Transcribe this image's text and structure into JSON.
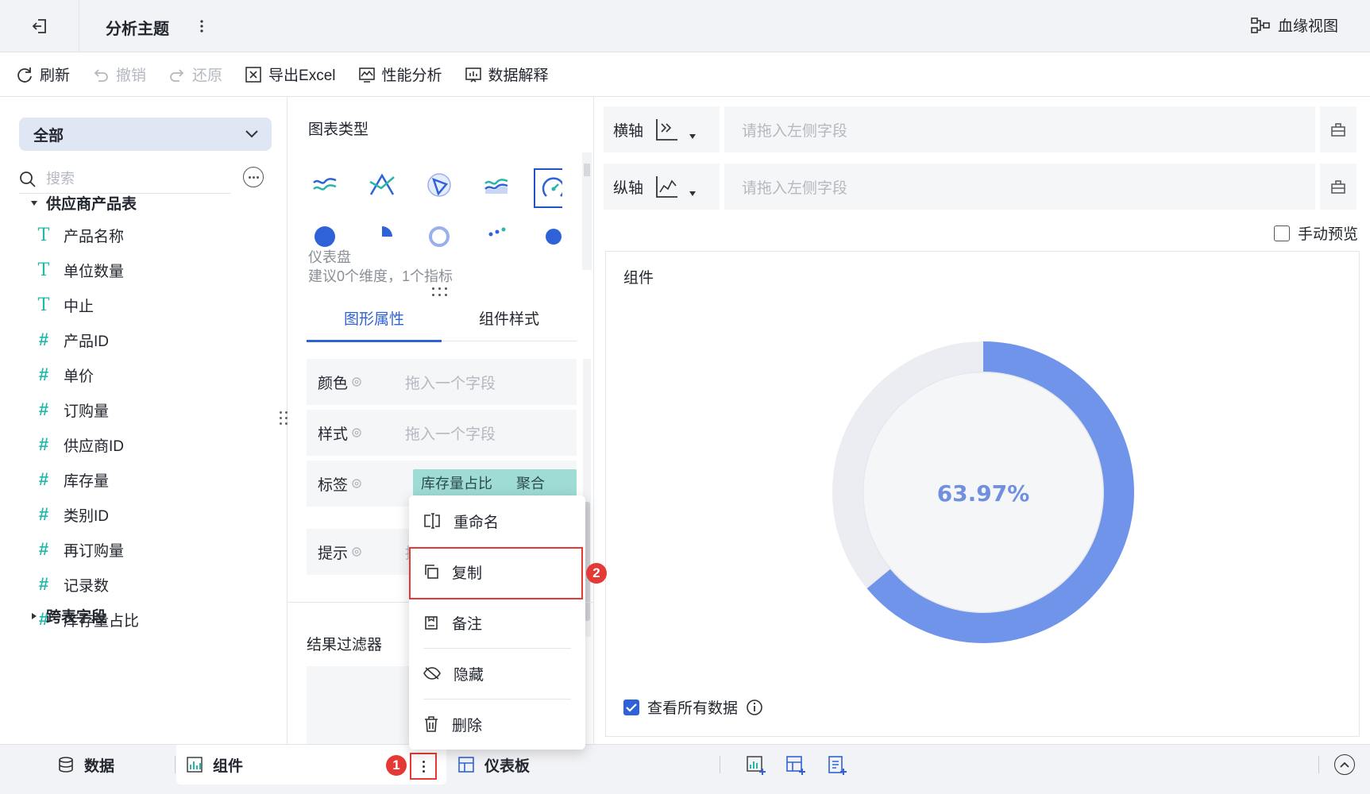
{
  "header": {
    "title": "分析主题",
    "lineage_label": "血缘视图"
  },
  "toolbar": {
    "refresh": "刷新",
    "undo": "撤销",
    "redo": "还原",
    "export": "导出Excel",
    "perf": "性能分析",
    "explain": "数据解释"
  },
  "left": {
    "scope": "全部",
    "search_placeholder": "搜索",
    "table_name": "供应商产品表",
    "fields": [
      {
        "type": "text",
        "name": "产品名称"
      },
      {
        "type": "text",
        "name": "单位数量"
      },
      {
        "type": "text",
        "name": "中止"
      },
      {
        "type": "number",
        "name": "产品ID"
      },
      {
        "type": "number",
        "name": "单价"
      },
      {
        "type": "number",
        "name": "订购量"
      },
      {
        "type": "number",
        "name": "供应商ID"
      },
      {
        "type": "number",
        "name": "库存量"
      },
      {
        "type": "number",
        "name": "类别ID"
      },
      {
        "type": "number",
        "name": "再订购量"
      },
      {
        "type": "count",
        "name": "记录数"
      },
      {
        "type": "calc",
        "name": "库存量占比"
      }
    ],
    "cross_table": "跨表字段"
  },
  "middle": {
    "chart_type_label": "图表类型",
    "chart_name": "仪表盘",
    "chart_hint": "建议0个维度，1个指标",
    "tabs": [
      "图形属性",
      "组件样式"
    ],
    "props": {
      "color": "颜色",
      "style": "样式",
      "label": "标签",
      "tooltip": "提示",
      "drop_placeholder": "拖入一个字段",
      "tooltip_placeholder": "拖",
      "label_field": "库存量占比",
      "label_agg": "聚合"
    },
    "filter_title": "结果过滤器"
  },
  "right": {
    "x_axis": "横轴",
    "y_axis": "纵轴",
    "axis_placeholder": "请拖入左侧字段",
    "manual_preview": "手动预览",
    "component_title": "组件",
    "gauge_value": "63.97%",
    "gauge_fraction": 0.6397,
    "view_all": "查看所有数据"
  },
  "context_menu": {
    "items": [
      "重命名",
      "复制",
      "备注",
      "隐藏",
      "删除"
    ]
  },
  "bottom": {
    "data_tab": "数据",
    "component_tab": "组件",
    "dashboard_tab": "仪表板",
    "badge1": "1",
    "badge2": "2"
  },
  "colors": {
    "accent": "#2f62d8",
    "gauge_fill": "#7094ea",
    "gauge_track": "#ebedf2",
    "field_icon": "#20b8a8",
    "highlight": "#e53935"
  }
}
